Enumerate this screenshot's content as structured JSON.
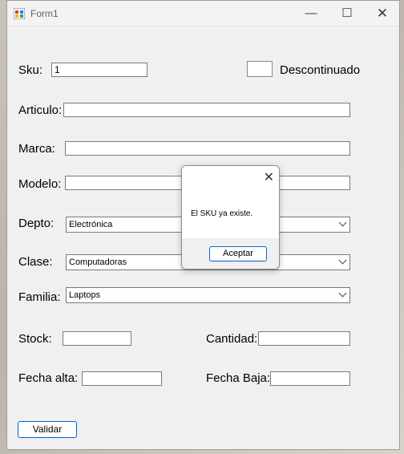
{
  "window": {
    "title": "Form1",
    "minimize": "—",
    "maximize": "☐",
    "close": "✕"
  },
  "form": {
    "sku_label": "Sku:",
    "sku_value": "1",
    "descontinuado_label": "Descontinuado",
    "articulo_label": "Articulo:",
    "articulo_value": "",
    "marca_label": "Marca:",
    "marca_value": "",
    "modelo_label": "Modelo:",
    "modelo_value": "",
    "depto_label": "Depto:",
    "depto_value": "Electrónica",
    "clase_label": "Clase:",
    "clase_value": "Computadoras",
    "familia_label": "Familia:",
    "familia_value": "Laptops",
    "stock_label": "Stock:",
    "stock_value": "",
    "cantidad_label": "Cantidad:",
    "cantidad_value": "",
    "fecha_alta_label": "Fecha alta:",
    "fecha_alta_value": "",
    "fecha_baja_label": "Fecha Baja:",
    "fecha_baja_value": "",
    "validar_label": "Validar"
  },
  "dialog": {
    "message": "El SKU ya existe.",
    "ok_label": "Aceptar",
    "close": "✕"
  }
}
